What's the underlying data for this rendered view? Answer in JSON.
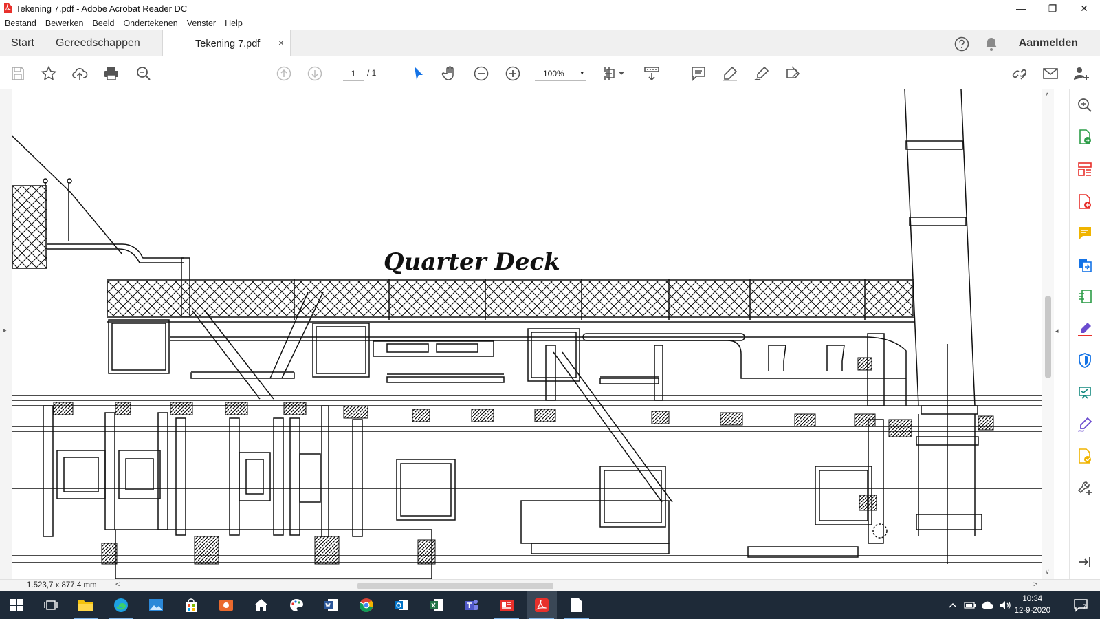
{
  "window": {
    "title": "Tekening 7.pdf - Adobe Acrobat Reader DC",
    "minimize_glyph": "—",
    "restore_glyph": "❐",
    "close_glyph": "✕"
  },
  "menu": [
    "Bestand",
    "Bewerken",
    "Beeld",
    "Ondertekenen",
    "Venster",
    "Help"
  ],
  "tabs": {
    "start": "Start",
    "tools": "Gereedschappen",
    "document": "Tekening 7.pdf",
    "close_glyph": "×",
    "signin": "Aanmelden"
  },
  "toolbar": {
    "page_current": "1",
    "page_total": "/ 1",
    "zoom": "100%",
    "zoom_caret": "▾"
  },
  "document": {
    "heading": "Quarter Deck"
  },
  "status": {
    "dimensions": "1.523,7 x 877,4 mm",
    "scroll_left": "<",
    "scroll_right": ">"
  },
  "scroll": {
    "up": "∧",
    "down": "∨",
    "left_panel": "▸",
    "right_panel": "◂"
  },
  "taskbar": {
    "time": "10:34",
    "date": "12-9-2020",
    "notifications": "7"
  },
  "colors": {
    "acrobat_red": "#e8302b",
    "tool_blue": "#1473e6",
    "tool_green": "#2d9d48",
    "tool_purple": "#6b4ccf",
    "tool_yellow": "#f0b400",
    "tool_teal": "#12897f",
    "taskbar": "#1e2a38"
  }
}
